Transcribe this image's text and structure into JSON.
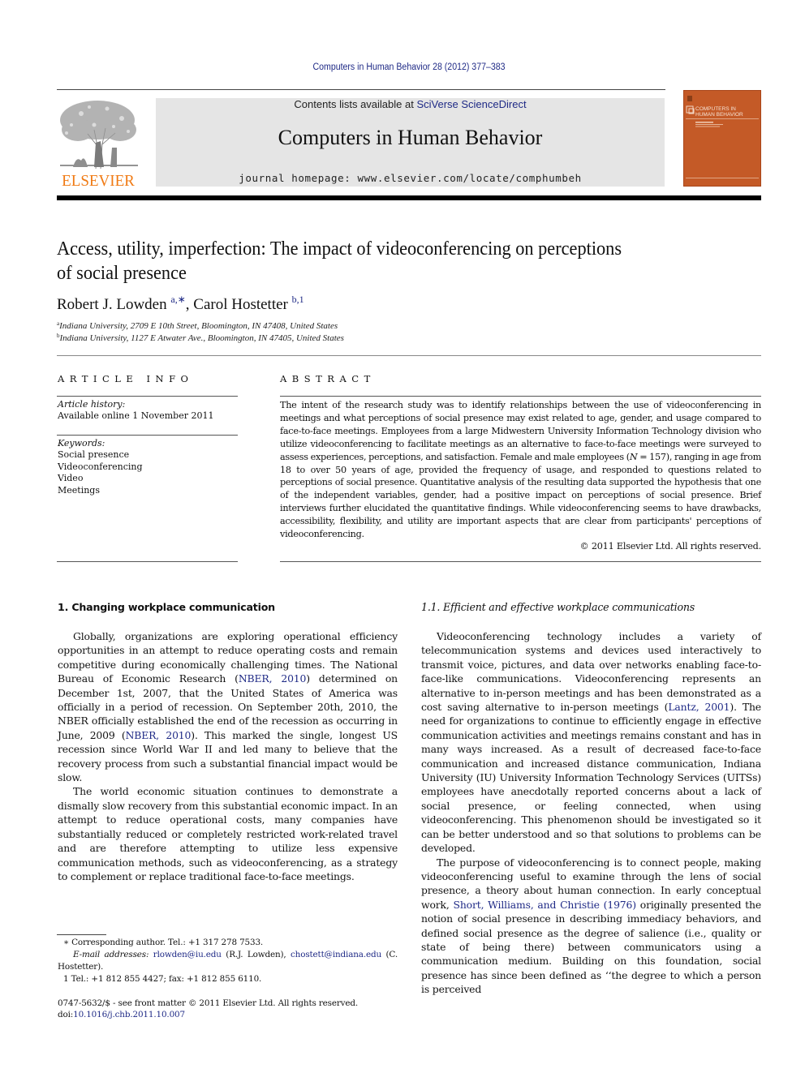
{
  "running_head": "Computers in Human Behavior 28 (2012) 377–383",
  "banner": {
    "contents_prefix": "Contents lists available at ",
    "contents_link": "SciVerse ScienceDirect",
    "journal_name": "Computers in Human Behavior",
    "homepage": "journal homepage: www.elsevier.com/locate/comphumbeh"
  },
  "publisher_logo": {
    "word": "ELSEVIER",
    "color": "#f07a13"
  },
  "cover": {
    "line1": "COMPUTERS IN",
    "line2": "HUMAN BEHAVIOR",
    "color": "#c45a27"
  },
  "article": {
    "title_line1": "Access, utility, imperfection: The impact of videoconferencing on perceptions",
    "title_line2": "of social presence",
    "authors": [
      {
        "name": "Robert J. Lowden",
        "marks": "a,∗"
      },
      {
        "name": "Carol Hostetter",
        "marks": "b,1"
      }
    ],
    "author_separator": ", ",
    "affiliations": [
      {
        "mark": "a",
        "text": "Indiana University, 2709 E 10th Street, Bloomington, IN 47408, United States"
      },
      {
        "mark": "b",
        "text": "Indiana University, 1127 E Atwater Ave., Bloomington, IN 47405, United States"
      }
    ]
  },
  "article_info": {
    "heading": "ARTICLE INFO",
    "history_label": "Article history:",
    "history_value": "Available online 1 November 2011",
    "keywords_label": "Keywords:",
    "keywords": [
      "Social presence",
      "Videoconferencing",
      "Video",
      "Meetings"
    ]
  },
  "abstract": {
    "heading": "ABSTRACT",
    "text_before_n": "The intent of the research study was to identify relationships between the use of videoconferencing in meetings and what perceptions of social presence may exist related to age, gender, and usage compared to face-to-face meetings. Employees from a large Midwestern University Information Technology division who utilize videoconferencing to facilitate meetings as an alternative to face-to-face meetings were surveyed to assess experiences, perceptions, and satisfaction. Female and male employees (",
    "n_symbol": "N",
    "text_after_n": " = 157), ranging in age from 18 to over 50 years of age, provided the frequency of usage, and responded to questions related to perceptions of social presence. Quantitative analysis of the resulting data supported the hypothesis that one of the independent variables, gender, had a positive impact on perceptions of social presence. Brief interviews further elucidated the quantitative findings. While videoconferencing seems to have drawbacks, accessibility, flexibility, and utility are important aspects that are clear from participants' perceptions of videoconferencing.",
    "copyright": "© 2011 Elsevier Ltd. All rights reserved."
  },
  "section1": {
    "heading": "1. Changing workplace communication",
    "p1_a": "Globally, organizations are exploring operational efficiency opportunities in an attempt to reduce operating costs and remain competitive during economically challenging times. The National Bureau of Economic Research (",
    "p1_cite1": "NBER, 2010",
    "p1_b": ") determined on December 1st, 2007, that the United States of America was officially in a period of recession. On September 20th, 2010, the NBER officially established the end of the recession as occurring in June, 2009 (",
    "p1_cite2": "NBER, 2010",
    "p1_c": "). This marked the single, longest US recession since World War II and led many to believe that the recovery process from such a substantial financial impact would be slow.",
    "p2": "The world economic situation continues to demonstrate a dismally slow recovery from this substantial economic impact. In an attempt to reduce operational costs, many companies have substantially reduced or completely restricted work-related travel and are therefore attempting to utilize less expensive communication methods, such as videoconferencing, as a strategy to complement or replace traditional face-to-face meetings."
  },
  "section1_1": {
    "heading": "1.1. Efficient and effective workplace communications",
    "p1_a": "Videoconferencing technology includes a variety of telecommunication systems and devices used interactively to transmit voice, pictures, and data over networks enabling face-to-face-like communications. Videoconferencing represents an alternative to in-person meetings and has been demonstrated as a cost saving alternative to in-person meetings (",
    "p1_cite": "Lantz, 2001",
    "p1_b": "). The need for organizations to continue to efficiently engage in effective communication activities and meetings remains constant and has in many ways increased. As a result of decreased face-to-face communication and increased distance communication, Indiana University (IU) University Information Technology Services (UITSs) employees have anecdotally reported concerns about a lack of social presence, or feeling connected, when using videoconferencing. This phenomenon should be investigated so it can be better understood and so that solutions to problems can be developed.",
    "p2_a": "The purpose of videoconferencing is to connect people, making videoconferencing useful to examine through the lens of social presence, a theory about human connection. In early conceptual work, ",
    "p2_cite": "Short, Williams, and Christie (1976)",
    "p2_b": " originally presented the notion of social presence in describing immediacy behaviors, and defined social presence as the degree of salience (i.e., quality or state of being there) between communicators using a communication medium. Building on this foundation, social presence has since been defined as ‘‘the degree to which a person is perceived"
  },
  "footnotes": {
    "corresponding": "∗  Corresponding author. Tel.: +1 317 278 7533.",
    "email_label": "E-mail addresses:",
    "email1": "rlowden@iu.edu",
    "email1_owner": " (R.J. Lowden), ",
    "email2": "chostett@indiana.edu",
    "email2_owner": " (C. Hostetter).",
    "fn1": "1  Tel.: +1 812 855 4427; fax: +1 812 855 6110."
  },
  "front_matter": {
    "issn": "0747-5632/$ - see front matter © 2011 Elsevier Ltd. All rights reserved.",
    "doi_prefix": "doi:",
    "doi": "10.1016/j.chb.2011.10.007"
  }
}
